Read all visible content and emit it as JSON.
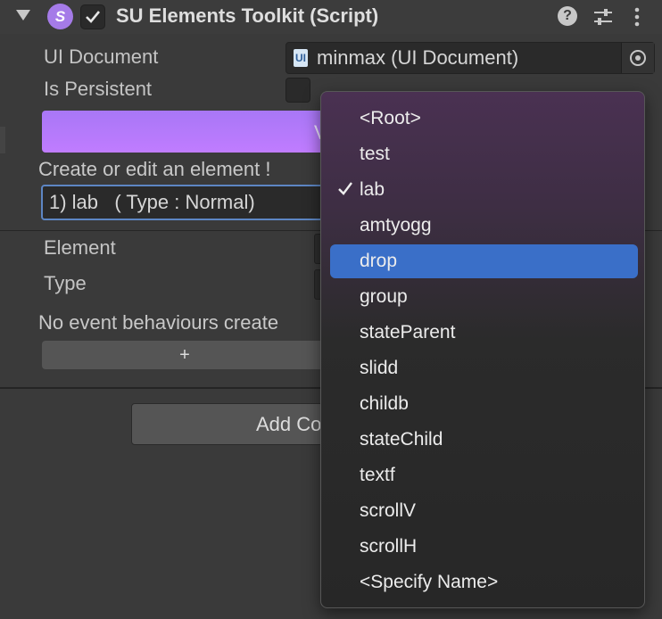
{
  "header": {
    "title": "SU Elements Toolkit (Script)",
    "enabled": true,
    "script_icon_letter": "S"
  },
  "fields": {
    "ui_document_label": "UI Document",
    "ui_document_value": "minmax (UI Document)",
    "ui_document_icon_text": "UI",
    "is_persistent_label": "Is Persistent",
    "is_persistent": false,
    "gradient_button_label": "V",
    "create_edit_label": "Create or edit an element !",
    "element_popup_value": "1) lab   ( Type : Normal)",
    "element_label": "Element",
    "type_label": "Type",
    "no_events_text": "No event behaviours create",
    "add_behaviour_label": "+",
    "add_component_label": "Add Co"
  },
  "menu": {
    "items": [
      {
        "label": "<Root>",
        "checked": false,
        "highlighted": false
      },
      {
        "label": "test",
        "checked": false,
        "highlighted": false
      },
      {
        "label": "lab",
        "checked": true,
        "highlighted": false
      },
      {
        "label": "amtyogg",
        "checked": false,
        "highlighted": false
      },
      {
        "label": "drop",
        "checked": false,
        "highlighted": true
      },
      {
        "label": "group",
        "checked": false,
        "highlighted": false
      },
      {
        "label": "stateParent",
        "checked": false,
        "highlighted": false
      },
      {
        "label": "slidd",
        "checked": false,
        "highlighted": false
      },
      {
        "label": "childb",
        "checked": false,
        "highlighted": false
      },
      {
        "label": "stateChild",
        "checked": false,
        "highlighted": false
      },
      {
        "label": "textf",
        "checked": false,
        "highlighted": false
      },
      {
        "label": "scrollV",
        "checked": false,
        "highlighted": false
      },
      {
        "label": "scrollH",
        "checked": false,
        "highlighted": false
      },
      {
        "label": "<Specify Name>",
        "checked": false,
        "highlighted": false
      }
    ]
  },
  "colors": {
    "accent_gradient_start": "#a877f6",
    "accent_gradient_end": "#c07cff",
    "menu_highlight": "#3a6fc8",
    "panel_bg": "#3a3a3a"
  }
}
